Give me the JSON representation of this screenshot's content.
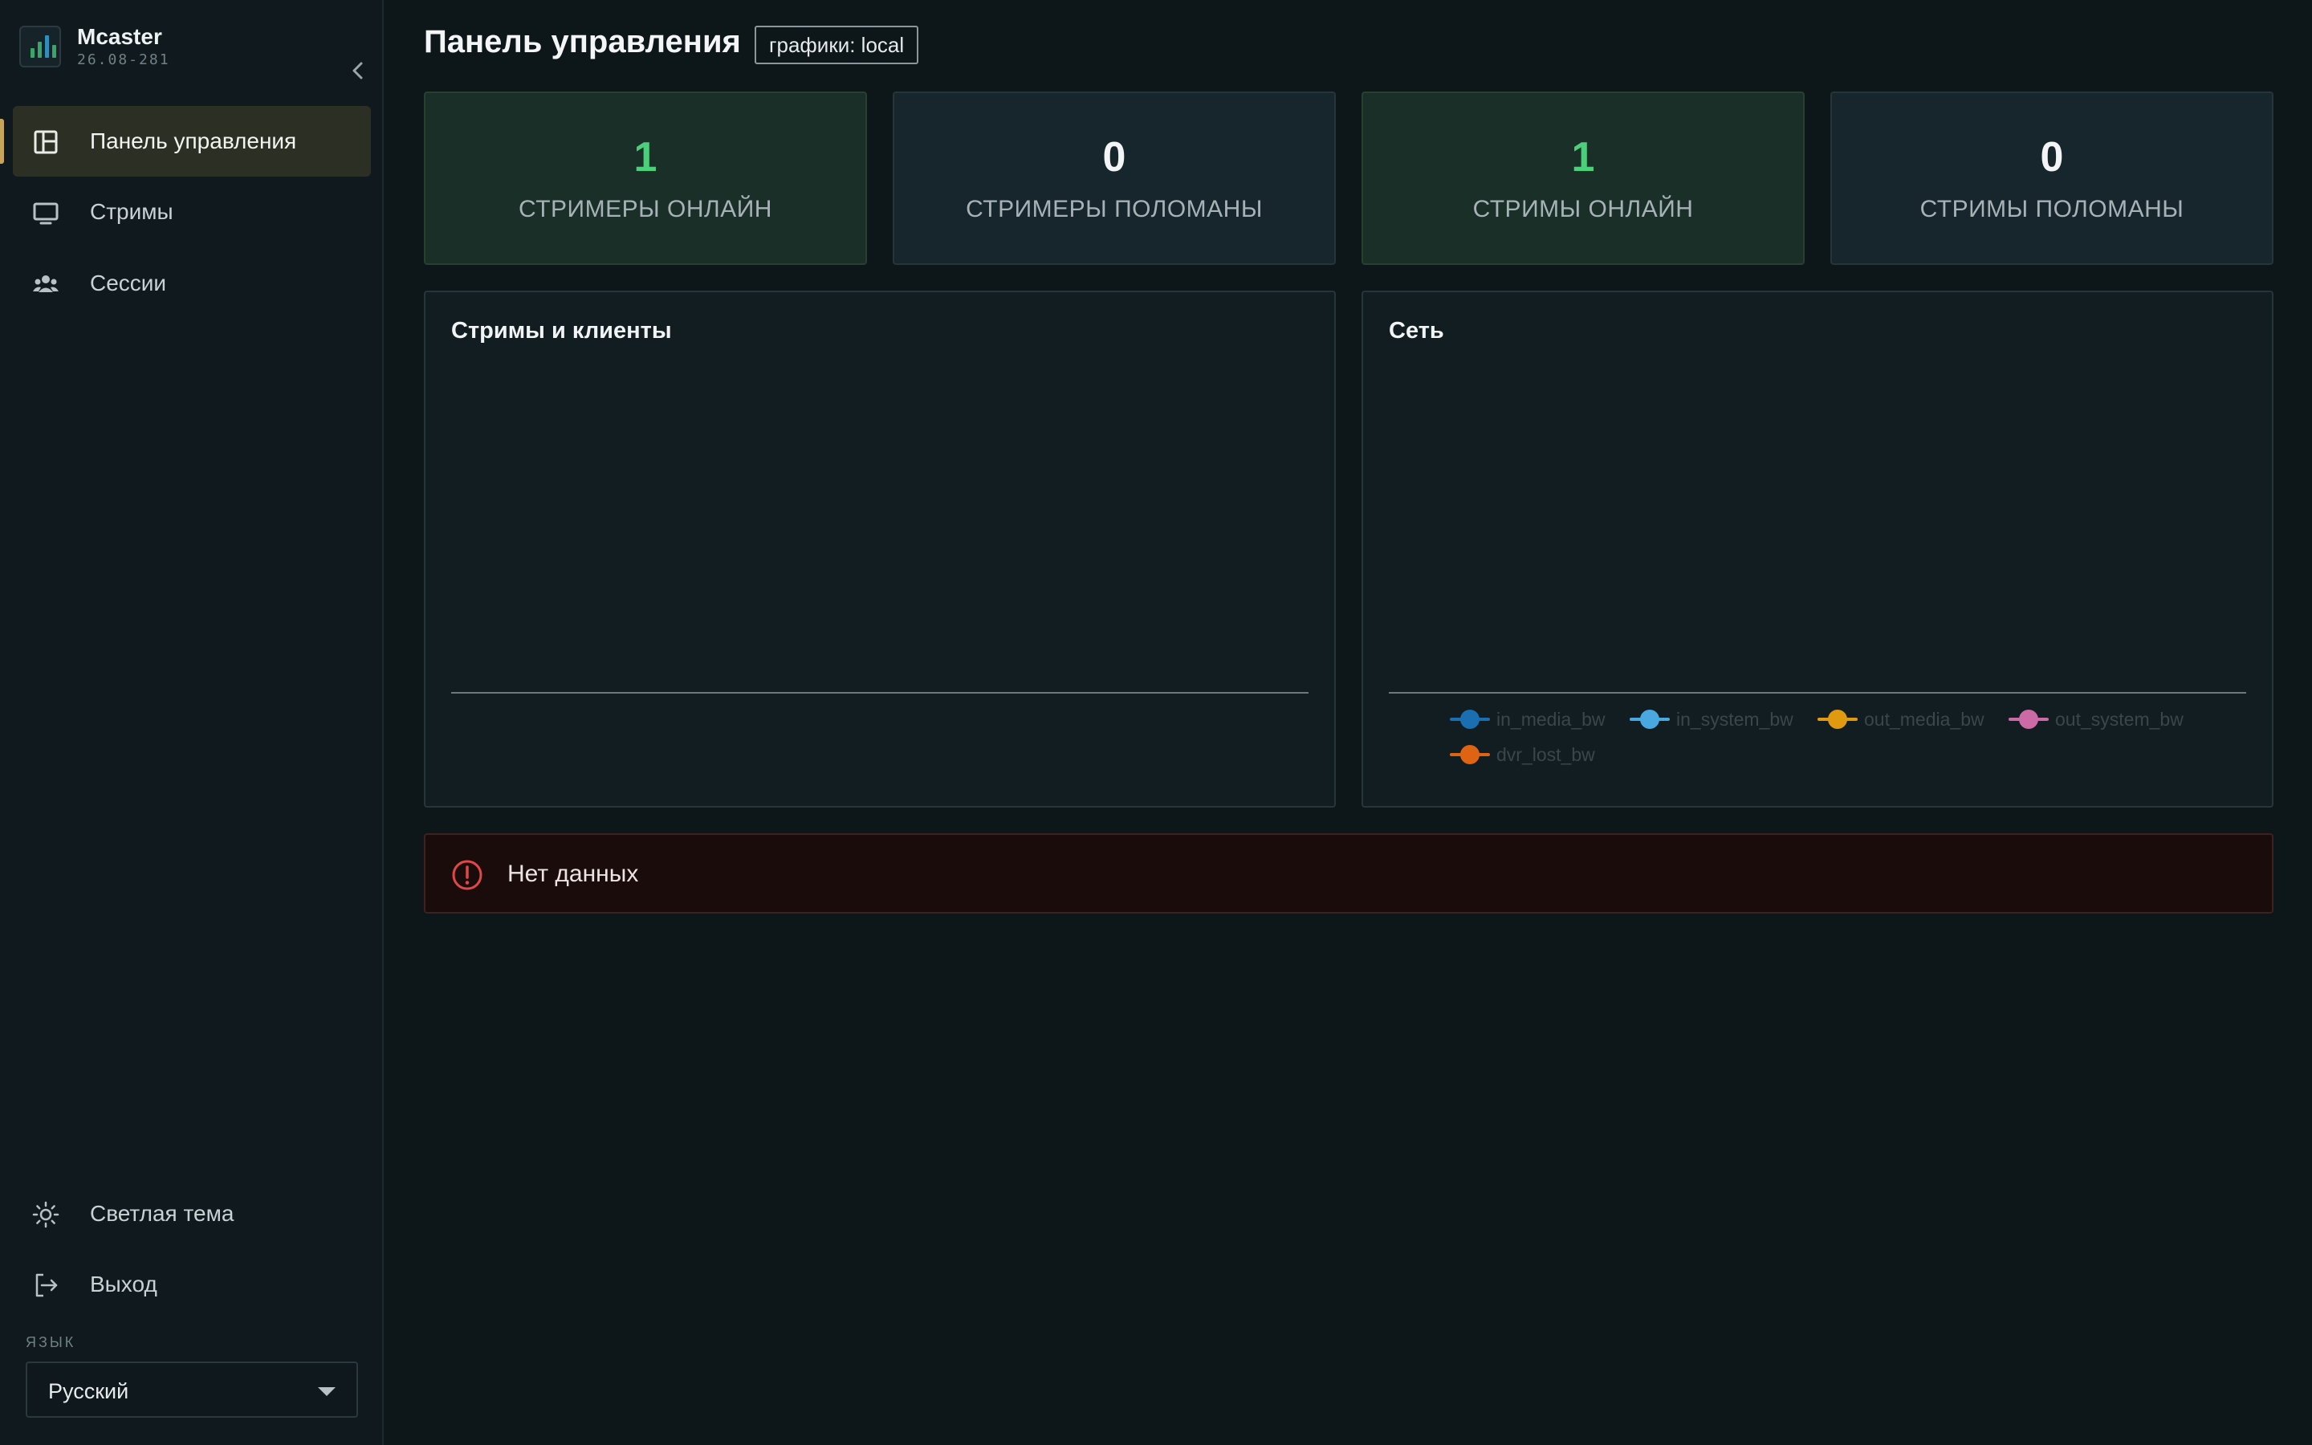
{
  "sidebar": {
    "app_name": "Mcaster",
    "version": "26.08-281",
    "nav": [
      {
        "label": "Панель управления",
        "icon": "dashboard-icon",
        "active": true
      },
      {
        "label": "Стримы",
        "icon": "monitor-icon",
        "active": false
      },
      {
        "label": "Сессии",
        "icon": "users-icon",
        "active": false
      }
    ],
    "bottom": [
      {
        "label": "Светлая тема",
        "icon": "sun-icon"
      },
      {
        "label": "Выход",
        "icon": "logout-icon"
      }
    ],
    "language": {
      "label": "ЯЗЫК",
      "value": "Русский"
    }
  },
  "header": {
    "title": "Панель управления",
    "badge": "графики: local"
  },
  "stats": [
    {
      "value": "1",
      "label": "СТРИМЕРЫ ОНЛАЙН",
      "status": "good"
    },
    {
      "value": "0",
      "label": "СТРИМЕРЫ ПОЛОМАНЫ",
      "status": "neutral"
    },
    {
      "value": "1",
      "label": "СТРИМЫ ОНЛАЙН",
      "status": "good"
    },
    {
      "value": "0",
      "label": "СТРИМЫ ПОЛОМАНЫ",
      "status": "neutral"
    }
  ],
  "panels": {
    "streams": {
      "title": "Стримы и клиенты"
    },
    "network": {
      "title": "Сеть",
      "legend": [
        {
          "name": "in_media_bw",
          "color": "#1a6fb0"
        },
        {
          "name": "in_system_bw",
          "color": "#4aa8e0"
        },
        {
          "name": "out_media_bw",
          "color": "#e09a10"
        },
        {
          "name": "out_system_bw",
          "color": "#cc6aa6"
        },
        {
          "name": "dvr_lost_bw",
          "color": "#dd6412"
        }
      ]
    }
  },
  "alert": {
    "text": "Нет данных",
    "icon": "alert-circle-icon",
    "color": "#e04848"
  },
  "colors": {
    "background": "#0d1619",
    "accent": "#c7a45a",
    "success": "#4ccf7a"
  }
}
